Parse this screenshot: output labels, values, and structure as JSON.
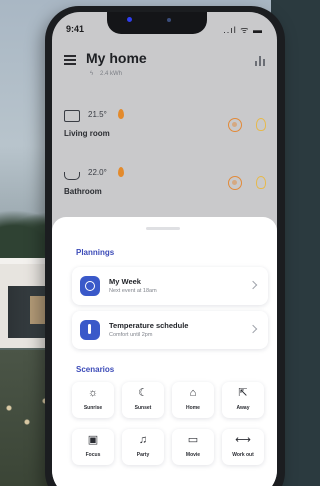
{
  "status_bar": {
    "time": "9:41",
    "icons": "..ıl ᯤ ▬"
  },
  "header": {
    "title": "My home",
    "subtitle": "2.4 kWh",
    "menu_icon": "menu-icon",
    "stats_icon": "bar-chart-icon"
  },
  "rooms": [
    {
      "name": "Living room",
      "temperature": "21.5°",
      "icon": "radiator-icon"
    },
    {
      "name": "Bathroom",
      "temperature": "22.0°",
      "icon": "bathtub-icon"
    }
  ],
  "plannings": {
    "title": "Plannings",
    "items": [
      {
        "title": "My Week",
        "subtitle": "Next event at 18am",
        "icon": "clock-icon"
      },
      {
        "title": "Temperature schedule",
        "subtitle": "Comfort until 2pm",
        "icon": "thermometer-icon"
      }
    ]
  },
  "scenarios": {
    "title": "Scenarios",
    "items": [
      {
        "label": "Sunrise",
        "glyph": "☼",
        "icon": "sunrise-icon"
      },
      {
        "label": "Sunset",
        "glyph": "☾",
        "icon": "moon-icon"
      },
      {
        "label": "Home",
        "glyph": "⌂",
        "icon": "home-icon"
      },
      {
        "label": "Away",
        "glyph": "⇱",
        "icon": "away-icon"
      },
      {
        "label": "Focus",
        "glyph": "▣",
        "icon": "briefcase-icon"
      },
      {
        "label": "Party",
        "glyph": "♫",
        "icon": "party-icon"
      },
      {
        "label": "Movie",
        "glyph": "▭",
        "icon": "tv-icon"
      },
      {
        "label": "Work out",
        "glyph": "⟷",
        "icon": "dumbbell-icon"
      }
    ]
  },
  "colors": {
    "accent": "#3a59c9",
    "section_title": "#3c4bb8",
    "heating": "#e28a39",
    "light": "#e6b94c"
  }
}
